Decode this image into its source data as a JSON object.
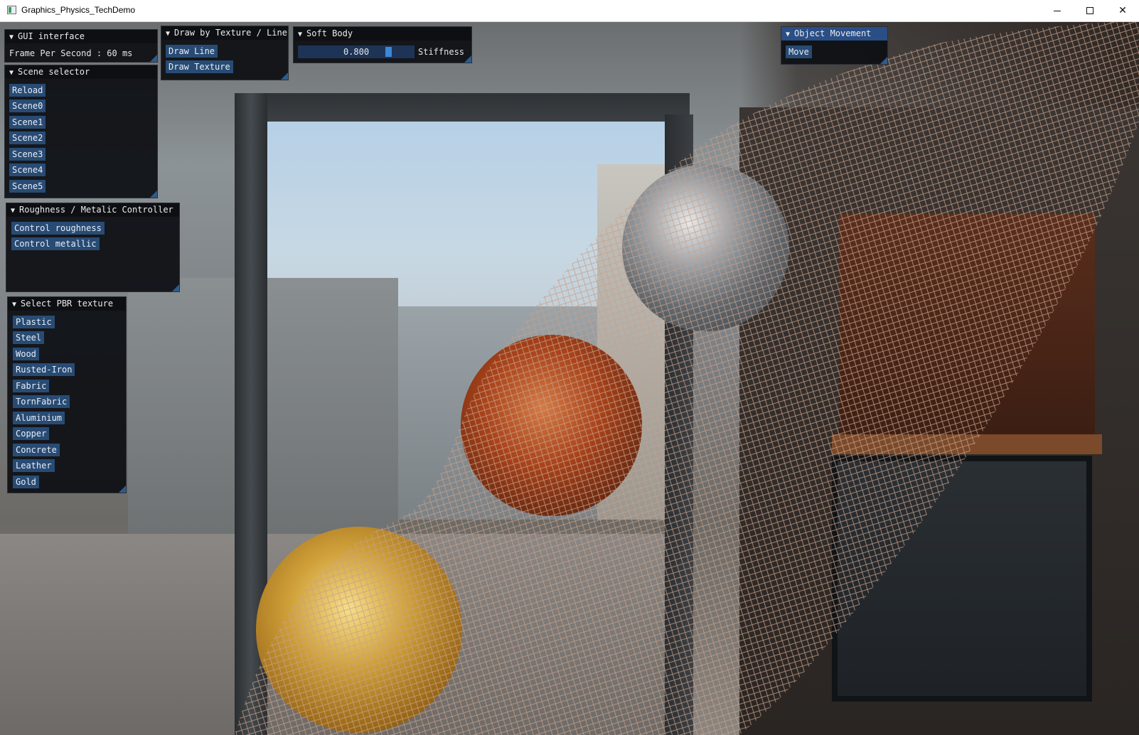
{
  "window": {
    "title": "Graphics_Physics_TechDemo",
    "controls": [
      "minimize",
      "maximize",
      "close"
    ],
    "close_glyph": "✕"
  },
  "panels": {
    "gui_interface": {
      "title": "GUI interface",
      "fps_text": "Frame Per Second : 60 ms"
    },
    "draw_mode": {
      "title": "Draw by Texture / Line",
      "buttons": [
        "Draw Line",
        "Draw Texture"
      ]
    },
    "soft_body": {
      "title": "Soft Body",
      "stiffness_value": "0.800",
      "stiffness_fraction": 0.8,
      "stiffness_label": "Stiffness"
    },
    "object_movement": {
      "title": "Object Movement",
      "buttons": [
        "Move"
      ]
    },
    "scene_selector": {
      "title": "Scene selector",
      "buttons": [
        "Reload",
        "Scene0",
        "Scene1",
        "Scene2",
        "Scene3",
        "Scene4",
        "Scene5"
      ]
    },
    "roughness_metalic": {
      "title": "Roughness / Metalic Controller",
      "buttons": [
        "Control roughness",
        "Control metallic"
      ]
    },
    "pbr_texture": {
      "title": "Select PBR texture",
      "buttons": [
        "Plastic",
        "Steel",
        "Wood",
        "Rusted-Iron",
        "Fabric",
        "TornFabric",
        "Aluminium",
        "Copper",
        "Concrete",
        "Leather",
        "Gold"
      ]
    }
  },
  "colors": {
    "panel_bg": "#0e1014",
    "button_bg": "#284b74",
    "active_header": "#2a4e86",
    "slider_grab": "#3d86d8",
    "mesh_line": "#c8a088"
  },
  "icons": {
    "app": "app-window-icon",
    "collapse": "triangle-down-icon"
  }
}
